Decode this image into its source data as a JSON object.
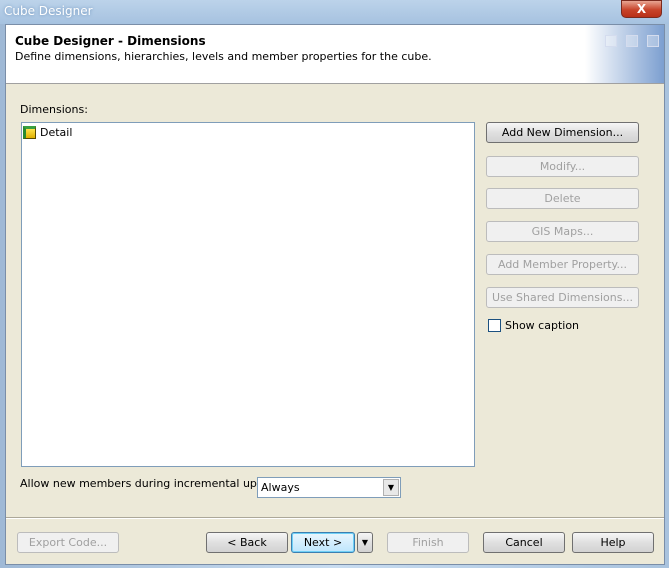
{
  "window": {
    "title": "Cube Designer",
    "close_label": "X"
  },
  "header": {
    "title": "Cube Designer - Dimensions",
    "subtitle": "Define dimensions, hierarchies, levels and member properties for the cube."
  },
  "dimensions": {
    "label": "Dimensions:",
    "items": [
      {
        "label": "Detail",
        "icon": "cube-icon"
      }
    ]
  },
  "side_buttons": {
    "add": "Add New Dimension...",
    "modify": "Modify...",
    "delete": "Delete",
    "gis": "GIS Maps...",
    "add_member": "Add Member Property...",
    "shared": "Use Shared Dimensions..."
  },
  "show_caption": {
    "label": "Show caption",
    "checked": false
  },
  "incremental": {
    "label": "Allow new members during incremental update:",
    "value": "Always"
  },
  "footer": {
    "export": "Export Code...",
    "back": "< Back",
    "next": "Next >",
    "finish": "Finish",
    "cancel": "Cancel",
    "help": "Help"
  }
}
